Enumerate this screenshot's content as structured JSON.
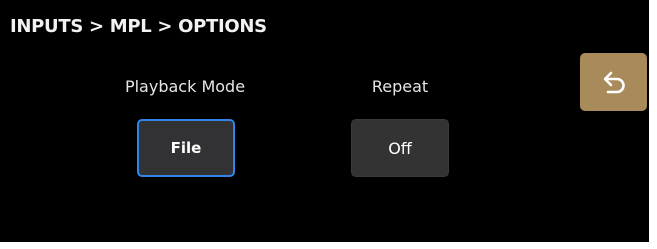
{
  "header": {
    "breadcrumb": "INPUTS > MPL > OPTIONS"
  },
  "options": {
    "playback_mode": {
      "label": "Playback Mode",
      "value": "File"
    },
    "repeat": {
      "label": "Repeat",
      "value": "Off"
    }
  },
  "back_button": {
    "icon": "undo-arrow-icon"
  },
  "colors": {
    "background": "#000000",
    "button": "#333333",
    "selected_border": "#2f86e8",
    "back_button": "#a98a5a"
  }
}
